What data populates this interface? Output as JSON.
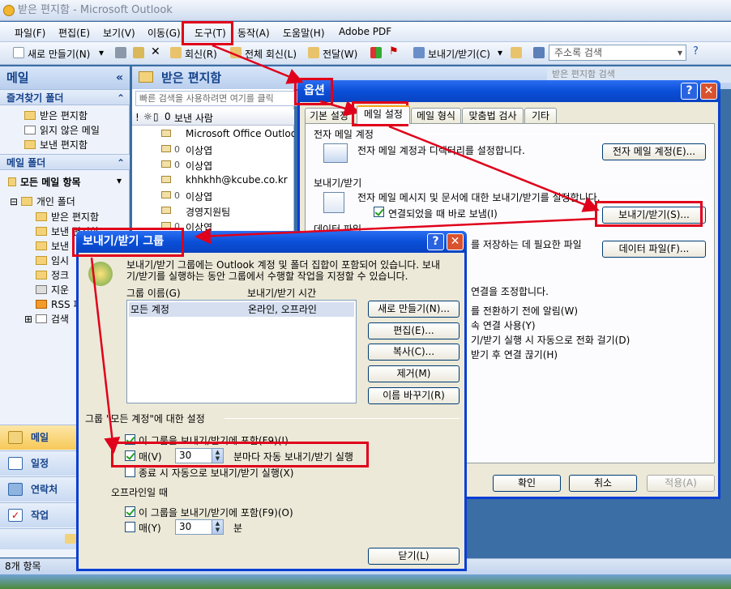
{
  "window": {
    "title": "받은 편지함 - Microsoft Outlook"
  },
  "menu": [
    "파일(F)",
    "편집(E)",
    "보기(V)",
    "이동(G)",
    "도구(T)",
    "동작(A)",
    "도움말(H)",
    "Adobe PDF"
  ],
  "toolbar": {
    "new": "새로 만들기(N)",
    "reply": "회신(R)",
    "reply_all": "전체 회신(L)",
    "forward": "전달(W)",
    "send_receive": "보내기/받기(C)",
    "address_search_placeholder": "주소록 검색",
    "search_placeholder": "받은 편지함 검색"
  },
  "nav": {
    "mail_header": "메일",
    "collapse": "«",
    "favorites_header": "즐겨찾기 폴더",
    "favorites": [
      "받은 편지함",
      "읽지 않은 메일",
      "보낸 편지함"
    ],
    "mail_folders_header": "메일 폴더",
    "all_mail": "모든 메일 항목",
    "personal": "개인 폴더",
    "folders": [
      "받은 편지함",
      "보낸 편지함",
      "보낸",
      "임시",
      "정크",
      "지운",
      "RSS 피",
      "검색"
    ],
    "bottom_buttons": [
      "메일",
      "일정",
      "연락처",
      "작업"
    ]
  },
  "list": {
    "title": "받은 편지함",
    "quick_search": "빠른 검색을 사용하려면 여기를 클릭",
    "sender_column": "보낸 사람",
    "rows": [
      "Microsoft Office Outlook",
      "이상엽",
      "이상엽",
      "khhkhh@kcube.co.kr",
      "이상엽",
      "경영지원팀",
      "이상엽"
    ]
  },
  "status": {
    "items": "8개 항목"
  },
  "options_dialog": {
    "title": "옵션",
    "tabs": [
      "기본 설정",
      "메일 설정",
      "메일 형식",
      "맞춤법 검사",
      "기타"
    ],
    "accounts_section": "전자 메일 계정",
    "accounts_desc": "전자 메일 계정과 디렉터리를 설정합니다.",
    "accounts_button": "전자 메일 계정(E)...",
    "sendrecv_section": "보내기/받기",
    "sendrecv_desc": "전자 메일 메시지 및 문서에 대한 보내기/받기를 설정합니다.",
    "send_immediately": "연결되었을 때 바로 보냄(I)",
    "sendrecv_button": "보내기/받기(S)...",
    "data_section": "데이터 파일",
    "data_desc": "를 저장하는 데 필요한 파일",
    "data_button": "데이터 파일(F)...",
    "dialup_desc": "연결을 조정합니다.",
    "dialup_1": "를 전환하기 전에 알림(W)",
    "dialup_2": "속 연결 사용(Y)",
    "dialup_3": "기/받기 실행 시 자동으로 전화 걸기(D)",
    "dialup_4": "받기 후 연결 끊기(H)",
    "ok": "확인",
    "cancel": "취소",
    "apply": "적용(A)"
  },
  "sr_dialog": {
    "title": "보내기/받기 그룹",
    "desc1": "보내기/받기 그룹에는 Outlook 계정 및 폴더 집합이 포함되어 있습니다. 보내",
    "desc2": "기/받기를 실행하는 동안 그룹에서 수행할 작업을 지정할 수 있습니다.",
    "col_name": "그룹 이름(G)",
    "col_time": "보내기/받기 시간",
    "group_name": "모든 계정",
    "group_time": "온라인, 오프라인",
    "btn_new": "새로 만들기(N)...",
    "btn_edit": "편집(E)...",
    "btn_copy": "복사(C)...",
    "btn_remove": "제거(M)",
    "btn_rename": "이름 바꾸기(R)",
    "settings_label": "그룹 \"모든 계정\"에 대한 설정",
    "include_online": "이 그룹을 보내기/받기에 포함(F9)(I)",
    "every_online": "매(V)",
    "every_online_value": "30",
    "every_online_suffix": "분마다 자동 보내기/받기 실행",
    "on_exit": "종료 시 자동으로 보내기/받기 실행(X)",
    "offline_label": "오프라인일 때",
    "include_offline": "이 그룹을 보내기/받기에 포함(F9)(O)",
    "every_offline": "매(Y)",
    "every_offline_value": "30",
    "every_offline_suffix": "분",
    "close": "닫기(L)"
  },
  "colors": {
    "xp_blue": "#0a4fd8",
    "annotation_red": "#e0001b",
    "outlook_blue": "#15428b"
  }
}
